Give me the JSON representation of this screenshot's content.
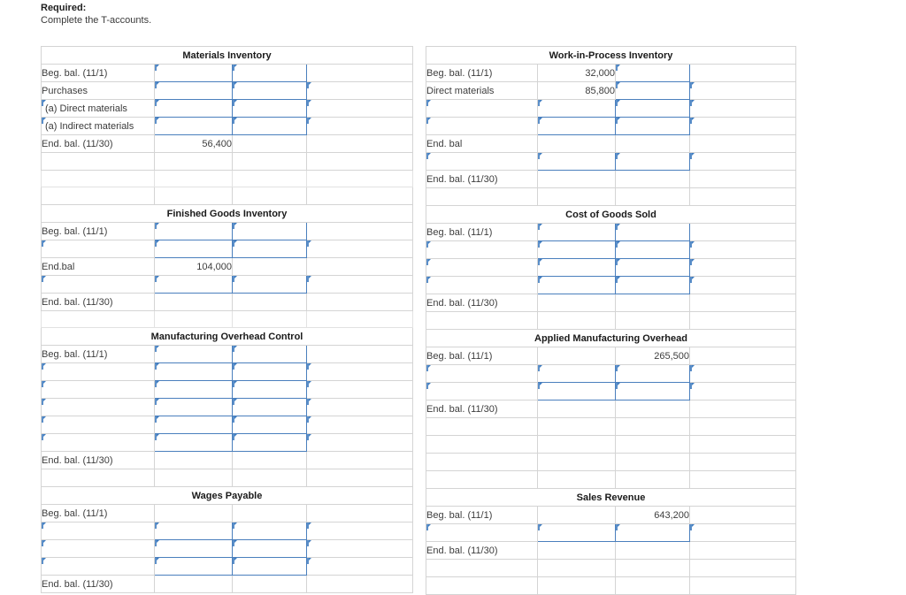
{
  "prompt": {
    "required_label": "Required:",
    "instruction": "Complete the T-accounts."
  },
  "colors": {
    "header_band": "#7dafe2",
    "input_border": "#5b8fc9",
    "input_marker": "#3f7cc0",
    "rule": "#3c3c3c",
    "text": "#3d3d3d"
  },
  "common": {
    "beg_bal": "Beg. bal. (11/1)",
    "end_bal": "End. bal. (11/30)",
    "end_bal_short": "End. bal",
    "end_bal_nospace": "End.bal",
    "empty": ""
  },
  "accounts": {
    "materials_inventory": {
      "title": "Materials Inventory",
      "rows": [
        {
          "label": "Beg. bal. (11/1)",
          "c1": "",
          "c2": "",
          "c3": ""
        },
        {
          "label": "Purchases",
          "c1": "",
          "c2": "",
          "c3": ""
        },
        {
          "label": "(a) Direct materials",
          "c1": "",
          "c2": "",
          "c3": ""
        },
        {
          "label": "(a) Indirect materials",
          "c1": "",
          "c2": "",
          "c3": ""
        },
        {
          "label": "End. bal. (11/30)",
          "c1": "56,400",
          "c2": "",
          "c3": ""
        },
        {
          "label": "",
          "c1": "",
          "c2": "",
          "c3": ""
        },
        {
          "label": "",
          "c1": "",
          "c2": "",
          "c3": ""
        },
        {
          "label": "",
          "c1": "",
          "c2": "",
          "c3": ""
        }
      ]
    },
    "work_in_process_inventory": {
      "title": "Work-in-Process Inventory",
      "rows": [
        {
          "label": "Beg. bal. (11/1)",
          "c1": "32,000",
          "c2": "",
          "c3": ""
        },
        {
          "label": "Direct materials",
          "c1": "85,800",
          "c2": "",
          "c3": ""
        },
        {
          "label": "",
          "c1": "",
          "c2": "",
          "c3": ""
        },
        {
          "label": "",
          "c1": "",
          "c2": "",
          "c3": ""
        },
        {
          "label": "End. bal",
          "c1": "",
          "c2": "",
          "c3": ""
        },
        {
          "label": "",
          "c1": "",
          "c2": "",
          "c3": ""
        },
        {
          "label": "End. bal. (11/30)",
          "c1": "",
          "c2": "",
          "c3": ""
        },
        {
          "label": "",
          "c1": "",
          "c2": "",
          "c3": ""
        }
      ]
    },
    "finished_goods_inventory": {
      "title": "Finished Goods Inventory",
      "rows": [
        {
          "label": "Beg. bal. (11/1)",
          "c1": "",
          "c2": "",
          "c3": ""
        },
        {
          "label": "",
          "c1": "",
          "c2": "",
          "c3": ""
        },
        {
          "label": "End.bal",
          "c1": "104,000",
          "c2": "",
          "c3": ""
        },
        {
          "label": "",
          "c1": "",
          "c2": "",
          "c3": ""
        },
        {
          "label": "End. bal. (11/30)",
          "c1": "",
          "c2": "",
          "c3": ""
        },
        {
          "label": "",
          "c1": "",
          "c2": "",
          "c3": ""
        }
      ]
    },
    "cost_of_goods_sold": {
      "title": "Cost of Goods Sold",
      "rows": [
        {
          "label": "Beg. bal. (11/1)",
          "c1": "",
          "c2": "",
          "c3": ""
        },
        {
          "label": "",
          "c1": "",
          "c2": "",
          "c3": ""
        },
        {
          "label": "",
          "c1": "",
          "c2": "",
          "c3": ""
        },
        {
          "label": "",
          "c1": "",
          "c2": "",
          "c3": ""
        },
        {
          "label": "End. bal. (11/30)",
          "c1": "",
          "c2": "",
          "c3": ""
        },
        {
          "label": "",
          "c1": "",
          "c2": "",
          "c3": ""
        }
      ]
    },
    "manufacturing_overhead_control": {
      "title": "Manufacturing Overhead Control",
      "rows": [
        {
          "label": "Beg. bal. (11/1)",
          "c1": "",
          "c2": "",
          "c3": ""
        },
        {
          "label": "",
          "c1": "",
          "c2": "",
          "c3": ""
        },
        {
          "label": "",
          "c1": "",
          "c2": "",
          "c3": ""
        },
        {
          "label": "",
          "c1": "",
          "c2": "",
          "c3": ""
        },
        {
          "label": "",
          "c1": "",
          "c2": "",
          "c3": ""
        },
        {
          "label": "",
          "c1": "",
          "c2": "",
          "c3": ""
        },
        {
          "label": "End. bal. (11/30)",
          "c1": "",
          "c2": "",
          "c3": ""
        },
        {
          "label": "",
          "c1": "",
          "c2": "",
          "c3": ""
        }
      ]
    },
    "applied_manufacturing_overhead": {
      "title": "Applied Manufacturing Overhead",
      "rows": [
        {
          "label": "Beg. bal. (11/1)",
          "c1": "",
          "c2": "265,500",
          "c3": ""
        },
        {
          "label": "",
          "c1": "",
          "c2": "",
          "c3": ""
        },
        {
          "label": "",
          "c1": "",
          "c2": "",
          "c3": ""
        },
        {
          "label": "End. bal. (11/30)",
          "c1": "",
          "c2": "",
          "c3": ""
        },
        {
          "label": "",
          "c1": "",
          "c2": "",
          "c3": ""
        },
        {
          "label": "",
          "c1": "",
          "c2": "",
          "c3": ""
        },
        {
          "label": "",
          "c1": "",
          "c2": "",
          "c3": ""
        },
        {
          "label": "",
          "c1": "",
          "c2": "",
          "c3": ""
        }
      ]
    },
    "wages_payable": {
      "title": "Wages Payable",
      "rows": [
        {
          "label": "Beg. bal. (11/1)",
          "c1": "",
          "c2": "",
          "c3": ""
        },
        {
          "label": "",
          "c1": "",
          "c2": "",
          "c3": ""
        },
        {
          "label": "",
          "c1": "",
          "c2": "",
          "c3": ""
        },
        {
          "label": "",
          "c1": "",
          "c2": "",
          "c3": ""
        },
        {
          "label": "End. bal. (11/30)",
          "c1": "",
          "c2": "",
          "c3": ""
        }
      ]
    },
    "sales_revenue": {
      "title": "Sales Revenue",
      "rows": [
        {
          "label": "Beg. bal. (11/1)",
          "c1": "",
          "c2": "643,200",
          "c3": ""
        },
        {
          "label": "",
          "c1": "",
          "c2": "",
          "c3": ""
        },
        {
          "label": "End. bal. (11/30)",
          "c1": "",
          "c2": "",
          "c3": ""
        },
        {
          "label": "",
          "c1": "",
          "c2": "",
          "c3": ""
        },
        {
          "label": "",
          "c1": "",
          "c2": "",
          "c3": ""
        }
      ]
    }
  }
}
